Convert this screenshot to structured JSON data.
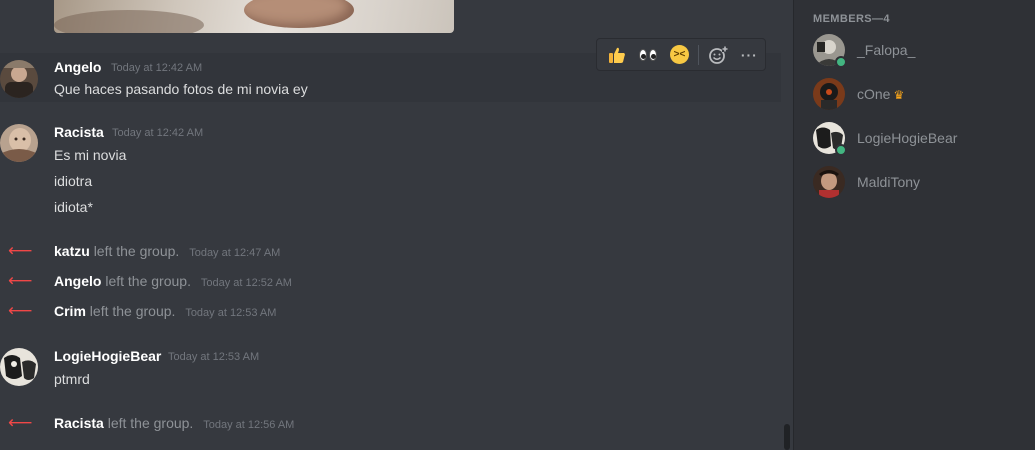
{
  "messages": [
    {
      "author": "Angelo",
      "timestamp": "Today at 12:42 AM",
      "lines": [
        "Que haces pasando fotos de mi novia ey"
      ]
    },
    {
      "author": "Racista",
      "timestamp": "Today at 12:42 AM",
      "lines": [
        "Es mi novia",
        "idiotra",
        "idiota*"
      ]
    },
    {
      "system": true,
      "user": "katzu",
      "action": "left the group.",
      "timestamp": "Today at 12:47 AM"
    },
    {
      "system": true,
      "user": "Angelo",
      "action": "left the group.",
      "timestamp": "Today at 12:52 AM"
    },
    {
      "system": true,
      "user": "Crim",
      "action": "left the group.",
      "timestamp": "Today at 12:53 AM"
    },
    {
      "author": "LogieHogieBear",
      "timestamp": "Today at 12:53 AM",
      "lines": [
        "ptmrd"
      ]
    },
    {
      "system": true,
      "user": "Racista",
      "action": "left the group.",
      "timestamp": "Today at 12:56 AM"
    }
  ],
  "toolbar": {
    "reactions": [
      "thumbs-up-emoji",
      "eyes-emoji",
      "laughing-emoji"
    ],
    "add_reaction_icon": "add-reaction-icon",
    "more_icon": "more-options-icon",
    "more_label": "···"
  },
  "members": {
    "header": "MEMBERS—4",
    "list": [
      {
        "name": "_Falopa_",
        "online": true,
        "owner": false
      },
      {
        "name": "cOne",
        "online": false,
        "owner": true
      },
      {
        "name": "LogieHogieBear",
        "online": true,
        "owner": false
      },
      {
        "name": "MaldiTony",
        "online": false,
        "owner": false
      }
    ]
  },
  "colors": {
    "background": "#36393f",
    "sidebar": "#2f3136",
    "leave_arrow": "#f04747",
    "online": "#43b581",
    "crown": "#faa61a"
  }
}
